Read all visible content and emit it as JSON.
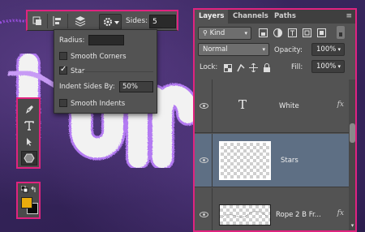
{
  "toolbar": {
    "sides_label": "Sides:",
    "sides_value": "5",
    "icons": [
      "path-operations-icon",
      "path-alignment-icon",
      "path-arrangement-icon",
      "gear-icon"
    ]
  },
  "shape_options": {
    "radius_label": "Radius:",
    "radius_value": "",
    "smooth_corners_label": "Smooth Corners",
    "smooth_corners_checked": false,
    "star_label": "Star",
    "star_checked": true,
    "indent_sides_label": "Indent Sides By:",
    "indent_sides_value": "50%",
    "smooth_indents_label": "Smooth Indents",
    "smooth_indents_checked": false
  },
  "tools": {
    "items": [
      "pen-tool-icon",
      "type-tool-icon",
      "path-selection-tool-icon",
      "polygon-tool-icon"
    ],
    "active": "polygon-tool-icon"
  },
  "colors": {
    "foreground": "#e9ac0d",
    "background": "#0b0b0b",
    "highlight_border": "#e0237f"
  },
  "layers_panel": {
    "tabs": [
      "Layers",
      "Channels",
      "Paths"
    ],
    "active_tab": "Layers",
    "filter_label": "Kind",
    "blend_mode": "Normal",
    "opacity_label": "Opacity:",
    "opacity_value": "100%",
    "lock_label": "Lock:",
    "fill_label": "Fill:",
    "fill_value": "100%",
    "layers": [
      {
        "name": "White",
        "type": "text",
        "fx": "fx",
        "selected": false
      },
      {
        "name": "Stars",
        "type": "pixel",
        "fx": "",
        "selected": true
      },
      {
        "name": "Rope 2 B Fr...",
        "type": "pixel",
        "fx": "fx",
        "selected": false
      }
    ]
  }
}
